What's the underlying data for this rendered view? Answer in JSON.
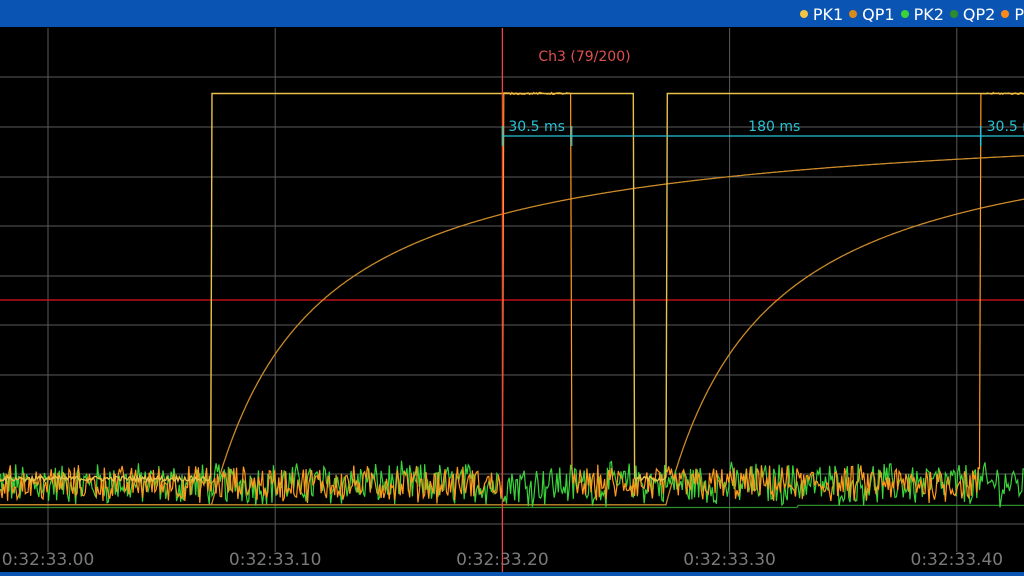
{
  "legend": {
    "items": [
      {
        "label": "PK1",
        "color": "#f5c542"
      },
      {
        "label": "QP1",
        "color": "#d98a1c"
      },
      {
        "label": "PK2",
        "color": "#3ad43a"
      },
      {
        "label": "QP2",
        "color": "#2e8b2e"
      },
      {
        "label": "P",
        "color": "#ff8a1c"
      }
    ]
  },
  "chart_data": {
    "type": "line",
    "x_tick_labels": [
      "0:32:33.00",
      "0:32:33.10",
      "0:32:33.20",
      "0:32:33.30",
      "0:32:33.40"
    ],
    "x_ticks": [
      0.0,
      0.1,
      0.2,
      0.3,
      0.4
    ],
    "xlim": [
      -0.02,
      0.43
    ],
    "ylim": [
      0,
      1
    ],
    "grid": true,
    "cursor": {
      "label": "Ch3 (79/200)",
      "x": 0.2,
      "color": "#ff4040"
    },
    "threshold": {
      "y": 0.555,
      "color": "#e0141e"
    },
    "measurements": [
      {
        "label": "30.5 ms",
        "x0": 0.2,
        "x1": 0.2305
      },
      {
        "label": "180 ms",
        "x0": 0.2305,
        "x1": 0.4105
      },
      {
        "label": "30.5 ms",
        "x0": 0.4105,
        "x1": 0.441
      }
    ],
    "series": [
      {
        "name": "PK1",
        "kind": "pulse",
        "color": "#e8c24a",
        "pulses": [
          [
            0.072,
            0.258
          ],
          [
            0.272,
            0.458
          ]
        ],
        "high": 0.875,
        "low": 0.14
      },
      {
        "name": "QP1",
        "kind": "recovery",
        "color": "#c98a2a",
        "starts": [
          0.072,
          0.272
        ],
        "high": 0.84,
        "low": 0.09,
        "tau": 0.045
      },
      {
        "name": "PK2",
        "kind": "noise",
        "color": "#3ad43a",
        "level": 0.13,
        "amp": 0.035
      },
      {
        "name": "QP2",
        "kind": "flat",
        "color": "#2e8b2e",
        "level": 0.085
      },
      {
        "name": "P",
        "kind": "noise-pulse",
        "color": "#ff9a1c",
        "level": 0.13,
        "amp": 0.03,
        "pulses": [
          [
            0.2,
            0.23
          ],
          [
            0.41,
            0.441
          ]
        ],
        "high": 0.875
      }
    ]
  }
}
